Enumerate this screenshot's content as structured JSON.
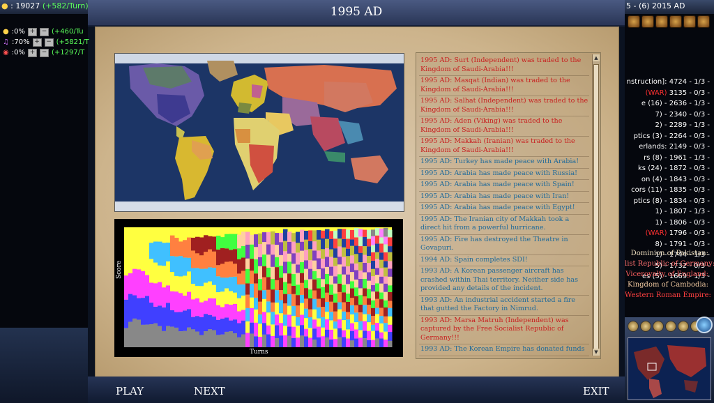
{
  "hud": {
    "gold": "19027",
    "gold_rate": "(+582/Turn)",
    "right_top": "5 - (6) 2015 AD",
    "rates": [
      {
        "pct": ":0%",
        "value": "(+460/Tu"
      },
      {
        "pct": ":70%",
        "value": "(+5821/T"
      },
      {
        "pct": ":0%",
        "value": "(+1297/T"
      }
    ]
  },
  "scoreboard": [
    {
      "name": "nstruction]:",
      "score": "4724 - 1/3 -",
      "war": false
    },
    {
      "name": "(WAR)",
      "score": "3135 - 0/3 -",
      "war": true
    },
    {
      "name": "e (16) -",
      "score": "2636 - 1/3 -",
      "war": false
    },
    {
      "name": "7) -",
      "score": "2340 - 0/3 -",
      "war": false
    },
    {
      "name": "2) -",
      "score": "2289 - 1/3 -",
      "war": false
    },
    {
      "name": "ptics (3) -",
      "score": "2264 - 0/3 -",
      "war": false
    },
    {
      "name": "erlands:",
      "score": "2149 - 0/3 -",
      "war": false
    },
    {
      "name": "rs (8) -",
      "score": "1961 - 1/3 -",
      "war": false
    },
    {
      "name": "ks (24) -",
      "score": "1872 - 0/3 -",
      "war": false
    },
    {
      "name": "on (4) -",
      "score": "1843 - 0/3 -",
      "war": false
    },
    {
      "name": "cors (11) -",
      "score": "1835 - 0/3 -",
      "war": false
    },
    {
      "name": "ptics (8) -",
      "score": "1834 - 0/3 -",
      "war": false
    },
    {
      "name": "1) -",
      "score": "1807 - 1/3 -",
      "war": false
    },
    {
      "name": "1) -",
      "score": "1806 - 0/3 -",
      "war": false
    },
    {
      "name": "(WAR)",
      "score": "1796 - 0/3 -",
      "war": true
    },
    {
      "name": "8) -",
      "score": "1791 - 0/3 -",
      "war": false
    },
    {
      "name": "1) -",
      "score": "1744 - 1/3 -",
      "war": false
    },
    {
      "name": "5) -",
      "score": "1732 - 0/3 -",
      "war": false
    },
    {
      "name": "es (5) -",
      "score": "1669 - 1/3 -",
      "war": false
    }
  ],
  "civs": [
    {
      "name": "Dominion of Pakistan:",
      "color": "#f0e0c0"
    },
    {
      "name": "list Republic of Germany:",
      "color": "#ff7070"
    },
    {
      "name": "Viceroyalty of England:",
      "color": "#ff6060"
    },
    {
      "name": "Kingdom of Cambodia:",
      "color": "#f0c8a0"
    },
    {
      "name": "Western Roman Empire:",
      "color": "#ff4040"
    }
  ],
  "popup": {
    "title": "1995 AD",
    "play": "PLAY",
    "next": "NEXT",
    "exit": "EXIT",
    "graph_ylabel": "Score",
    "graph_xlabel": "Turns"
  },
  "events": [
    {
      "text": "1995 AD: Surt (Independent) was traded to the Kingdom of Saudi-Arabia!!!",
      "type": "red"
    },
    {
      "text": "1995 AD: Masqat (Indian) was traded to the Kingdom of Saudi-Arabia!!!",
      "type": "red"
    },
    {
      "text": "1995 AD: Salhat (Independent) was traded to the Kingdom of Saudi-Arabia!!!",
      "type": "red"
    },
    {
      "text": "1995 AD: Aden (Viking) was traded to the Kingdom of Saudi-Arabia!!!",
      "type": "red"
    },
    {
      "text": "1995 AD: Makkah (Iranian) was traded to the Kingdom of Saudi-Arabia!!!",
      "type": "red"
    },
    {
      "text": "1995 AD: Turkey has made peace with Arabia!",
      "type": "blue"
    },
    {
      "text": "1995 AD: Arabia has made peace with Russia!",
      "type": "blue"
    },
    {
      "text": "1995 AD: Arabia has made peace with Spain!",
      "type": "blue"
    },
    {
      "text": "1995 AD: Arabia has made peace with Iran!",
      "type": "blue"
    },
    {
      "text": "1995 AD: Arabia has made peace with Egypt!",
      "type": "blue"
    },
    {
      "text": "1995 AD: The Iranian city of Makkah took a direct hit from a powerful hurricane.",
      "type": "blue"
    },
    {
      "text": "1995 AD: Fire has destroyed the Theatre in Govapuri.",
      "type": "blue"
    },
    {
      "text": "1994 AD: Spain completes SDI!",
      "type": "blue"
    },
    {
      "text": "1993 AD: A Korean passenger aircraft has crashed within Thai territory. Neither side has provided any details of the incident.",
      "type": "blue"
    },
    {
      "text": "1993 AD: An industrial accident started a fire that gutted the Factory in Nimrud.",
      "type": "blue"
    },
    {
      "text": "1993 AD: Marsa Matruh (Independent) was captured by the Free Socialist Republic of Germany!!!",
      "type": "red"
    },
    {
      "text": "1993 AD: The Korean Empire has donated funds",
      "type": "blue"
    }
  ]
}
